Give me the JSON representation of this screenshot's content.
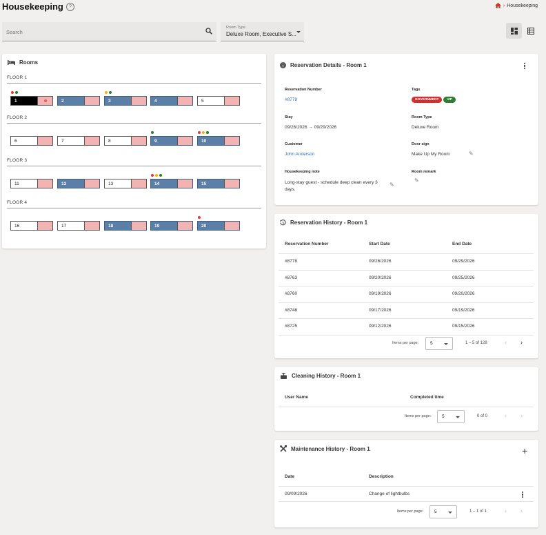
{
  "header": {
    "title": "Housekeeping",
    "breadcrumb": "Housekeeping"
  },
  "search": {
    "placeholder": "Search"
  },
  "room_type": {
    "label": "Room Type",
    "value": "Deluxe Room, Executive S..."
  },
  "rooms_card": {
    "title": "Rooms",
    "floors": [
      {
        "label": "FLOOR 1",
        "rooms": [
          {
            "num": "1",
            "state": "sel",
            "dots": [
              "#e53935",
              "#2e7d32"
            ]
          },
          {
            "num": "2",
            "state": "occ",
            "dots": []
          },
          {
            "num": "3",
            "state": "occ",
            "dots": [
              "#f5b400",
              "#2e7d32"
            ]
          },
          {
            "num": "4",
            "state": "occ",
            "dots": []
          },
          {
            "num": "5",
            "state": "vac",
            "dots": []
          }
        ]
      },
      {
        "label": "FLOOR 2",
        "rooms": [
          {
            "num": "6",
            "state": "vac",
            "dots": []
          },
          {
            "num": "7",
            "state": "vac",
            "dots": []
          },
          {
            "num": "8",
            "state": "vac",
            "dots": []
          },
          {
            "num": "9",
            "state": "occ",
            "dots": [
              "#2e7d32"
            ]
          },
          {
            "num": "10",
            "state": "occ",
            "dots": [
              "#e53935",
              "#f5b400",
              "#2e7d32"
            ]
          }
        ]
      },
      {
        "label": "FLOOR 3",
        "rooms": [
          {
            "num": "11",
            "state": "vac",
            "dots": []
          },
          {
            "num": "12",
            "state": "occ",
            "dots": []
          },
          {
            "num": "13",
            "state": "vac",
            "dots": []
          },
          {
            "num": "14",
            "state": "occ",
            "dots": [
              "#e53935",
              "#f5b400",
              "#2e7d32"
            ]
          },
          {
            "num": "15",
            "state": "occ",
            "dots": []
          }
        ]
      },
      {
        "label": "FLOOR 4",
        "rooms": [
          {
            "num": "16",
            "state": "vac",
            "dots": []
          },
          {
            "num": "17",
            "state": "vac",
            "dots": []
          },
          {
            "num": "18",
            "state": "occ",
            "dots": []
          },
          {
            "num": "19",
            "state": "occ",
            "dots": []
          },
          {
            "num": "20",
            "state": "occ",
            "dots": [
              "#e53935"
            ]
          }
        ]
      }
    ]
  },
  "reservation_details": {
    "title": "Reservation Details - Room 1",
    "reservation_number_label": "Reservation Number",
    "reservation_number": "#8778",
    "tags_label": "Tags",
    "tags": [
      {
        "text": "GOVERNMENT",
        "color": "#d32f2f"
      },
      {
        "text": "VIP",
        "color": "#2e7d32"
      }
    ],
    "stay_label": "Stay",
    "stay": "09/26/2026 → 09/29/2026",
    "room_type_label": "Room Type",
    "room_type": "Deluxe Room",
    "customer_label": "Customer",
    "customer": "John Anderson",
    "door_sign_label": "Door sign",
    "door_sign": "Make Up My Room",
    "hk_note_label": "Housekeeping note",
    "hk_note": "Long-stay guest - schedule deep clean every 3 days.",
    "room_remark_label": "Room remark"
  },
  "reservation_history": {
    "title": "Reservation History - Room 1",
    "columns": [
      "Reservation Number",
      "Start Date",
      "End Date"
    ],
    "rows": [
      [
        "#8778",
        "09/26/2026",
        "09/29/2026"
      ],
      [
        "#8763",
        "09/20/2026",
        "09/25/2026"
      ],
      [
        "#8760",
        "09/19/2026",
        "09/20/2026"
      ],
      [
        "#8746",
        "09/17/2026",
        "09/19/2026"
      ],
      [
        "#8725",
        "09/12/2026",
        "09/15/2026"
      ]
    ],
    "items_per_page_label": "Items per page:",
    "items_per_page": "5",
    "range": "1 – 5 of 128"
  },
  "cleaning_history": {
    "title": "Cleaning History - Room 1",
    "columns": [
      "User Name",
      "Completed time"
    ],
    "items_per_page_label": "Items per page:",
    "items_per_page": "5",
    "range": "0 of 0"
  },
  "maintenance_history": {
    "title": "Maintenance History - Room 1",
    "columns": [
      "Date",
      "Description"
    ],
    "rows": [
      [
        "09/09/2026",
        "Change of lightbulbs"
      ]
    ],
    "items_per_page_label": "Items per page:",
    "items_per_page": "5",
    "range": "1 – 1 of 1"
  }
}
